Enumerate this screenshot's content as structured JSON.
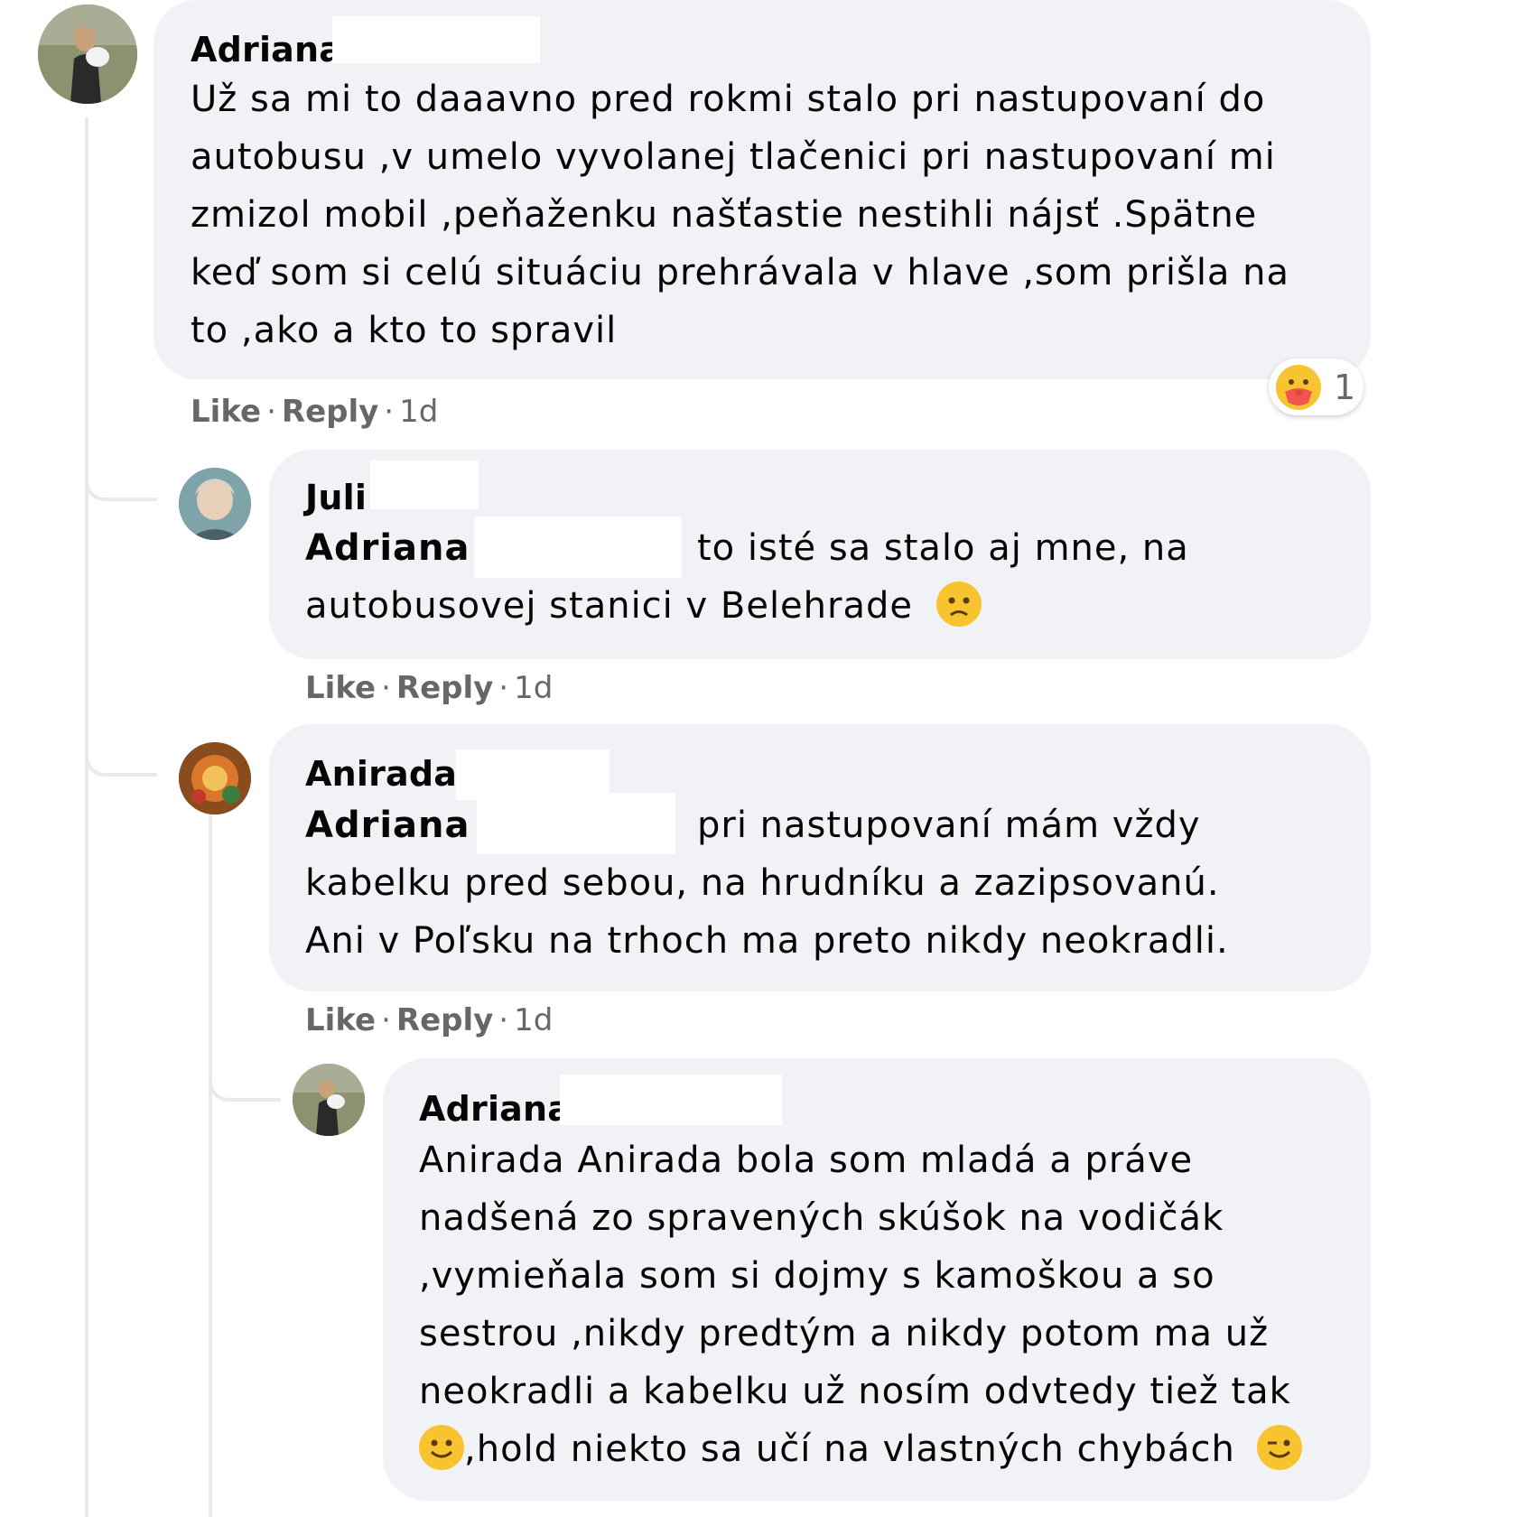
{
  "comments": [
    {
      "author": "Adriana",
      "lines": [
        "Už sa mi to daaavno pred rokmi stalo pri nastupovaní do",
        "autobusu ,v umelo vyvolanej tlačenici pri nastupovaní mi",
        "zmizol mobil ,peňaženku našťastie nestihli nájsť .Spätne",
        "keď som si celú situáciu prehrávala v hlave ,som prišla na",
        "to ,ako a kto to spravil"
      ],
      "actions": {
        "like": "Like",
        "reply": "Reply",
        "time": "1d"
      },
      "reaction": {
        "icon": "care-emoji-icon",
        "count": "1"
      }
    },
    {
      "author": "Juli",
      "mention": "Adriana",
      "lines": [
        "to isté sa stalo aj mne, na",
        "autobusovej stanici v Belehrade"
      ],
      "actions": {
        "like": "Like",
        "reply": "Reply",
        "time": "1d"
      }
    },
    {
      "author": "Anirada",
      "mention": "Adriana",
      "lines": [
        "pri nastupovaní mám vždy",
        "kabelku pred sebou, na hrudníku a zazipsovanú.",
        "Ani v Poľsku na trhoch ma preto nikdy neokradli."
      ],
      "actions": {
        "like": "Like",
        "reply": "Reply",
        "time": "1d"
      }
    },
    {
      "author": "Adriana",
      "lines": [
        "Anirada Anirada bola som mladá a práve",
        "nadšená zo spravených skúšok na vodičák",
        ",vymieňala som si dojmy s kamoškou a so",
        "sestrou ,nikdy predtým a nikdy potom ma už",
        "neokradli a kabelku už nosím odvtedy tiež tak",
        ",hold niekto sa učí na vlastných chybách"
      ]
    }
  ],
  "colors": {
    "bubble": "#f0f2f5",
    "meta_text": "#65676b",
    "thread_line": "#e8eaee"
  }
}
